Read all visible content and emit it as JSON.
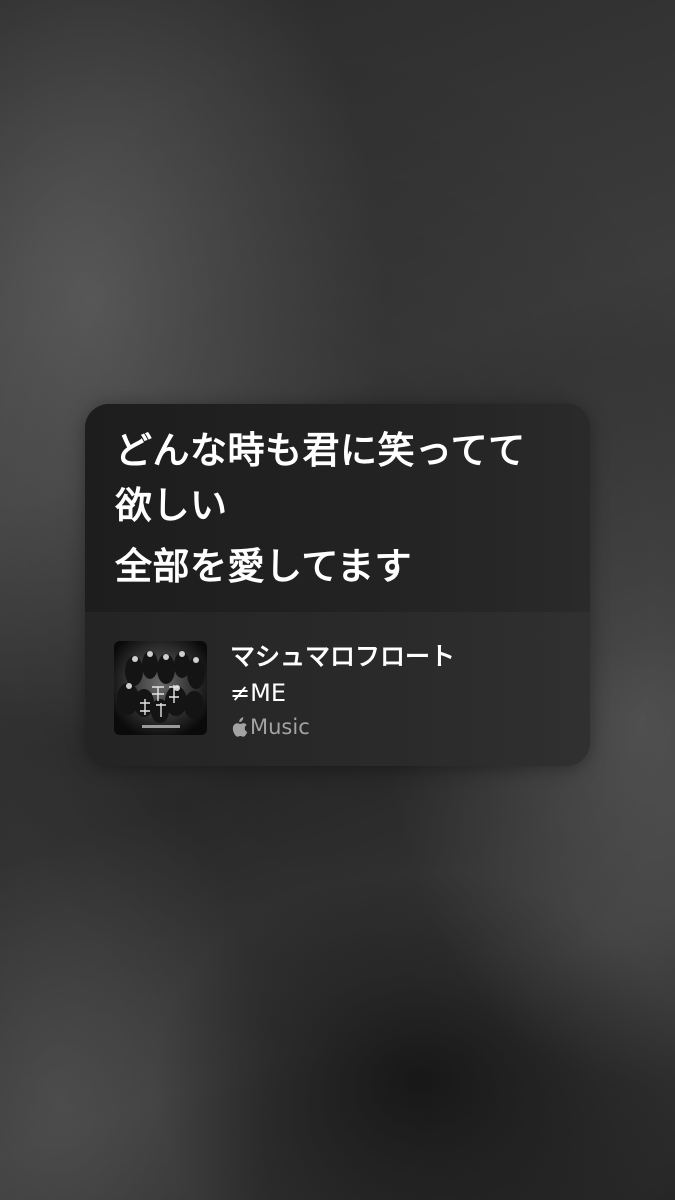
{
  "lyrics": {
    "lines": [
      "どんな時も君に笑ってて",
      "欲しい",
      "全部を愛してます"
    ]
  },
  "song": {
    "title": "マシュマロフロート",
    "artist": "≠ME",
    "service_label": "Music",
    "service_icon": "apple-logo-icon",
    "artwork_icon": "album-artwork-image"
  },
  "colors": {
    "card_background": "#242424",
    "primary_text": "#ffffff",
    "secondary_text": "#a3a3a3"
  }
}
